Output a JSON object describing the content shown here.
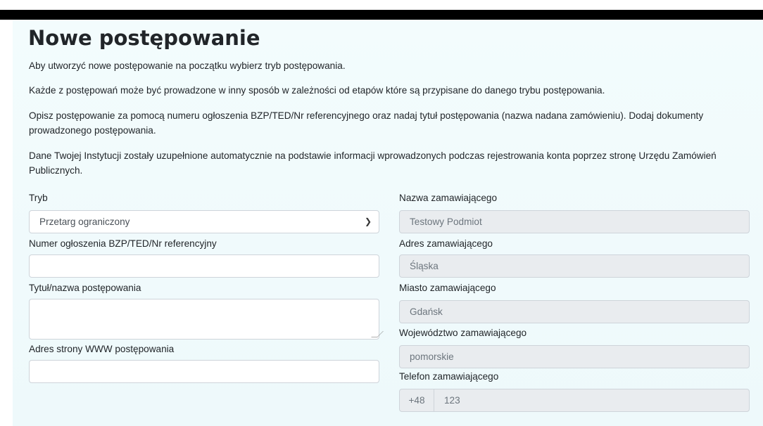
{
  "page": {
    "title": "Nowe postępowanie",
    "paragraphs": [
      "Aby utworzyć nowe postępowanie na początku wybierz tryb postępowania.",
      "Każde z postępowań może być prowadzone w inny sposób w zależności od etapów które są przypisane do danego trybu postępowania.",
      "Opisz postępowanie za pomocą numeru ogłoszenia BZP/TED/Nr referencyjnego oraz nadaj tytuł postępowania (nazwa nadana zamówieniu). Dodaj dokumenty prowadzonego postępowania.",
      "Dane Twojej Instytucji zostały uzupełnione automatycznie na podstawie informacji wprowadzonych podczas rejestrowania konta poprzez stronę Urzędu Zamówień Publicznych."
    ]
  },
  "form": {
    "tryb": {
      "label": "Tryb",
      "value": "Przetarg ograniczony"
    },
    "numer": {
      "label": "Numer ogłoszenia BZP/TED/Nr referencyjny",
      "value": ""
    },
    "tytul": {
      "label": "Tytuł/nazwa postępowania",
      "value": ""
    },
    "www": {
      "label": "Adres strony WWW postępowania",
      "value": ""
    },
    "nazwa": {
      "label": "Nazwa zamawiającego",
      "value": "Testowy Podmiot"
    },
    "adres": {
      "label": "Adres zamawiającego",
      "value": "Śląska"
    },
    "miasto": {
      "label": "Miasto zamawiającego",
      "value": "Gdańsk"
    },
    "wojewodztwo": {
      "label": "Województwo zamawiającego",
      "value": "pomorskie"
    },
    "telefon": {
      "label": "Telefon zamawiającego",
      "prefix": "+48",
      "value": "123"
    }
  },
  "icons": {
    "select_chevron": "chevron-down-icon"
  }
}
